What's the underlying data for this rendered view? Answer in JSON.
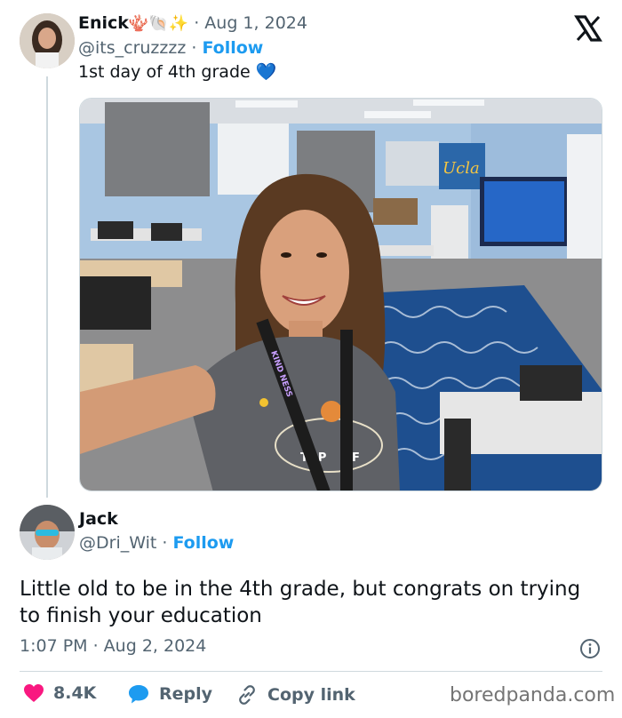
{
  "post": {
    "author_name": "Enick",
    "name_emojis": "🪸🐚✨",
    "date_text": "Aug 1, 2024",
    "handle": "@its_cruzzzz",
    "separator": " · ",
    "follow_label": "Follow",
    "text": "1st day of 4th grade",
    "heart_emoji": "💙",
    "photo_banner_text": "Ucla",
    "shirt_text_left": "TOP",
    "shirt_text_right": "OF",
    "lanyard_text": "KIND NESS"
  },
  "reply": {
    "author_name": "Jack",
    "handle": "@Dri_Wit",
    "separator": " · ",
    "follow_label": "Follow",
    "text": "Little old to be in the 4th grade, but congrats on trying to finish your education",
    "timestamp": "1:07 PM · Aug 2, 2024"
  },
  "actions": {
    "like_count": "8.4K",
    "reply_label": "Reply",
    "copy_link_label": "Copy link"
  },
  "watermark": "boredpanda.com",
  "colors": {
    "follow_blue": "#1d9bf0",
    "like_red": "#f91880",
    "reply_blue": "#1d9bf0",
    "muted": "#536471"
  },
  "icons": [
    "x-logo-icon",
    "info-icon",
    "heart-icon",
    "reply-bubble-icon",
    "link-icon"
  ]
}
